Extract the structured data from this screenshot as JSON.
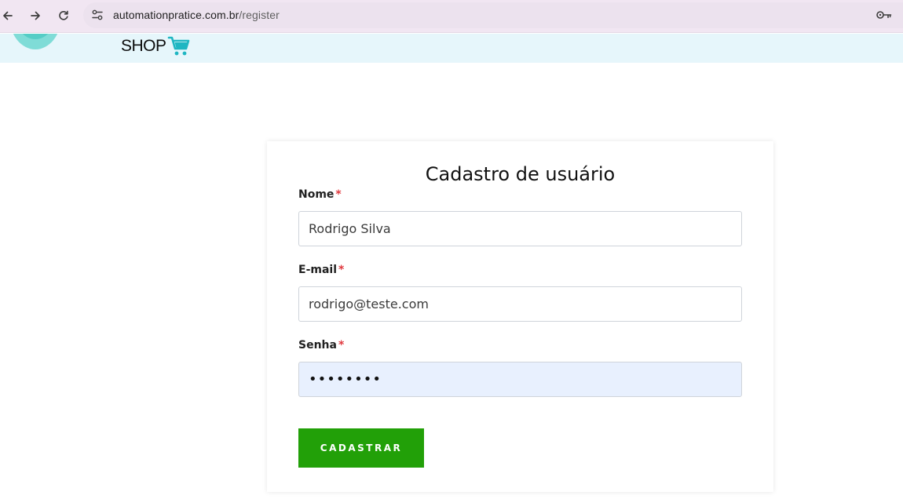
{
  "browser": {
    "url_domain": "automationpratice.com.br",
    "url_path": "/register",
    "back_icon": "arrow-left-icon",
    "forward_icon": "arrow-right-icon",
    "reload_icon": "reload-icon",
    "site_info_icon": "tune-icon",
    "password_icon": "key-icon"
  },
  "header": {
    "shop_text": "SHOP",
    "cart_icon": "shopping-cart-icon",
    "brand_color": "#1fb6c2"
  },
  "form": {
    "title": "Cadastro de usuário",
    "required_marker": "*",
    "fields": [
      {
        "label": "Nome",
        "value": "Rodrigo Silva"
      },
      {
        "label": "E-mail",
        "value": "rodrigo@teste.com"
      },
      {
        "label": "Senha",
        "value": "••••••••"
      }
    ],
    "submit_label": "CADASTRAR",
    "submit_color": "#22a008"
  }
}
